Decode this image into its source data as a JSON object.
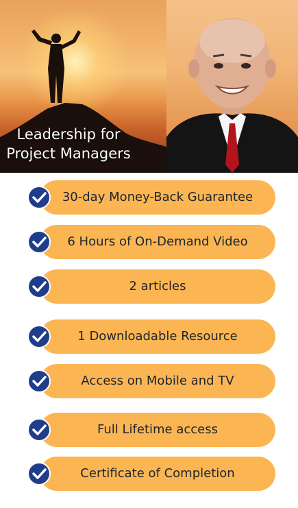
{
  "hero": {
    "title_line1": "Leadership for",
    "title_line2": "Project Managers"
  },
  "features": [
    {
      "label": "30-day Money-Back Guarantee",
      "icon": "check-circle-icon"
    },
    {
      "label": "6 Hours of On-Demand Video",
      "icon": "check-circle-icon"
    },
    {
      "label": "2 articles",
      "icon": "check-circle-icon"
    },
    {
      "label": "1 Downloadable Resource",
      "icon": "check-circle-icon"
    },
    {
      "label": "Access on Mobile and TV",
      "icon": "check-circle-icon"
    },
    {
      "label": "Full Lifetime access",
      "icon": "check-circle-icon"
    },
    {
      "label": "Certificate of Completion",
      "icon": "check-circle-icon"
    }
  ],
  "colors": {
    "pill": "#fbb653",
    "check": "#1f3d8a",
    "text": "#20252e"
  }
}
